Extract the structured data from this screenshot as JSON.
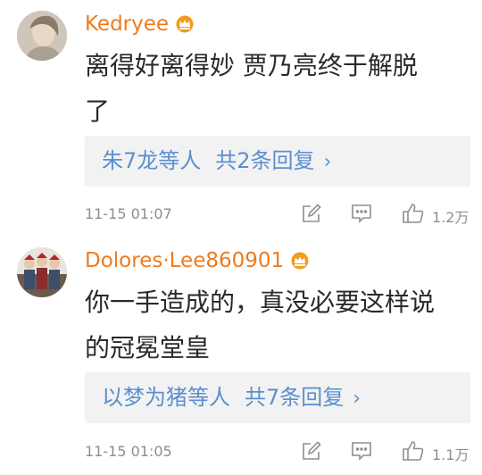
{
  "comments": [
    {
      "username": "Kedryee",
      "badge_icon": "crown-badge-icon",
      "text_line1": "离得好离得妙 贾乃亮终于解脱",
      "text_line2": "了",
      "reply_names": "朱7龙等人",
      "reply_count": "共2条回复",
      "reply_chevron": "›",
      "timestamp": "11-15 01:07",
      "likes": "1.2万"
    },
    {
      "username": "Dolores·Lee860901",
      "badge_icon": "crown-badge-icon",
      "text_line1": "你一手造成的，真没必要这样说",
      "text_line2": "的冠冕堂皇",
      "reply_names": "以梦为猪等人",
      "reply_count": "共7条回复",
      "reply_chevron": "›",
      "timestamp": "11-15 01:05",
      "likes": "1.1万"
    }
  ],
  "colors": {
    "username": "#ee7b1e",
    "reply_link": "#5a8fcf",
    "reply_bg": "#f2f2f2",
    "meta_text": "#8e8e8e",
    "icon_gray": "#8e8e8e"
  }
}
